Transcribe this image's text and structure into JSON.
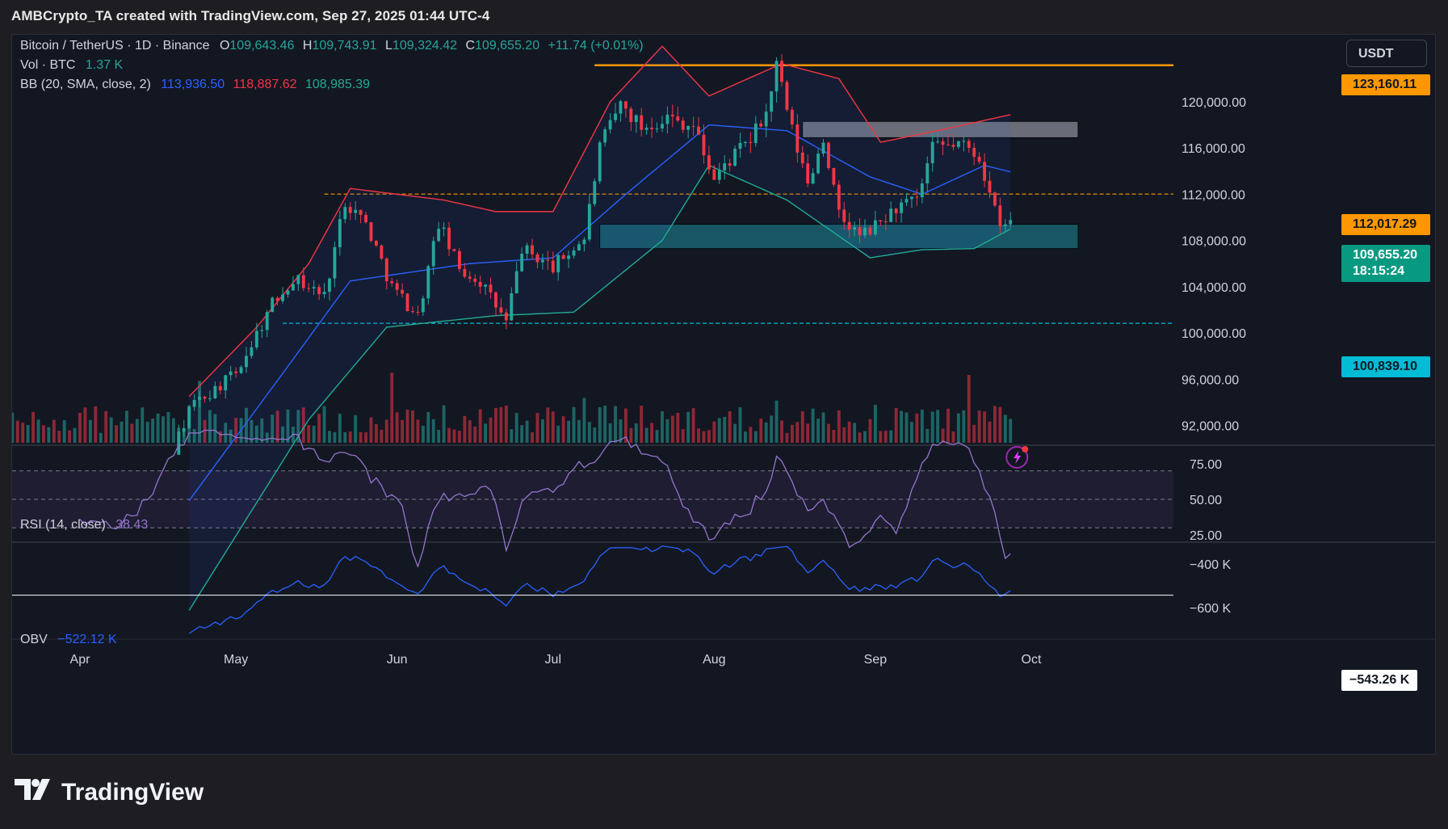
{
  "header": {
    "text": "AMBCrypto_TA created with TradingView.com, Sep 27, 2025 01:44 UTC-4"
  },
  "legend": {
    "symbol": "Bitcoin / TetherUS · 1D · Binance",
    "o_label": "O",
    "o_value": "109,643.46",
    "h_label": "H",
    "h_value": "109,743.91",
    "l_label": "L",
    "l_value": "109,324.42",
    "c_label": "C",
    "c_value": "109,655.20",
    "change": "+11.74 (+0.01%)",
    "vol_label": "Vol · BTC",
    "vol_value": "1.37 K",
    "bb_label": "BB (20, SMA, close, 2)",
    "bb_basis": "113,936.50",
    "bb_upper": "118,887.62",
    "bb_lower": "108,985.39",
    "rsi_label": "RSI (14, close)",
    "rsi_value": "38.43",
    "obv_label": "OBV",
    "obv_value": "−522.12 K"
  },
  "currency_button": "USDT",
  "price_tags": {
    "resistance": "123,160.11",
    "level": "112,017.29",
    "last_price": "109,655.20",
    "countdown": "18:15:24",
    "support": "100,839.10",
    "obv_current": "−543.26 K"
  },
  "colors": {
    "up": "#26a69a",
    "down": "#f23645",
    "bb_basis": "#2962ff",
    "bb_upper": "#f23645",
    "bb_lower": "#22ab94",
    "rsi": "#9575cd",
    "obv": "#2962ff",
    "resistance": "#ff9800",
    "support": "#00bcd4"
  },
  "footer": {
    "brand": "TradingView"
  },
  "chart_data": {
    "type": "candlestick",
    "symbol": "BTCUSDT",
    "price_axis": {
      "ticks": [
        "120,000.00",
        "116,000.00",
        "112,000.00",
        "108,000.00",
        "104,000.00",
        "100,000.00",
        "96,000.00",
        "92,000.00"
      ],
      "range": [
        90500,
        125800
      ]
    },
    "time_axis": {
      "ticks": [
        "Apr",
        "May",
        "Jun",
        "Jul",
        "Aug",
        "Sep",
        "Oct"
      ]
    },
    "rsi_axis": {
      "ticks": [
        "75.00",
        "50.00",
        "25.00"
      ]
    },
    "obv_axis": {
      "ticks": [
        "−400 K",
        "−600 K"
      ]
    },
    "horizontal_levels": [
      {
        "price": 123160.11,
        "style": "solid",
        "color": "#ff9800"
      },
      {
        "price": 112017.29,
        "style": "dashed",
        "color": "#ff9800"
      },
      {
        "price": 100839.1,
        "style": "dashed",
        "color": "#00bcd4"
      }
    ],
    "zones": [
      {
        "from_date": "2025-08-18",
        "to_date": "2025-10-10",
        "low": 116900,
        "high": 118300,
        "color": "grey"
      },
      {
        "from_date": "2025-07-10",
        "to_date": "2025-10-10",
        "low": 107300,
        "high": 109400,
        "color": "teal"
      }
    ],
    "close_path": [
      {
        "date": "2025-03-20",
        "close": 86000
      },
      {
        "date": "2025-04-01",
        "close": 84000
      },
      {
        "date": "2025-04-09",
        "close": 82500
      },
      {
        "date": "2025-04-15",
        "close": 84500
      },
      {
        "date": "2025-04-22",
        "close": 93500
      },
      {
        "date": "2025-05-01",
        "close": 96500
      },
      {
        "date": "2025-05-08",
        "close": 102500
      },
      {
        "date": "2025-05-12",
        "close": 104800
      },
      {
        "date": "2025-05-18",
        "close": 103200
      },
      {
        "date": "2025-05-22",
        "close": 111500
      },
      {
        "date": "2025-05-26",
        "close": 109500
      },
      {
        "date": "2025-05-31",
        "close": 104000
      },
      {
        "date": "2025-06-05",
        "close": 101500
      },
      {
        "date": "2025-06-09",
        "close": 109500
      },
      {
        "date": "2025-06-13",
        "close": 105500
      },
      {
        "date": "2025-06-17",
        "close": 104500
      },
      {
        "date": "2025-06-22",
        "close": 100900
      },
      {
        "date": "2025-06-25",
        "close": 107300
      },
      {
        "date": "2025-07-01",
        "close": 105700
      },
      {
        "date": "2025-07-07",
        "close": 108200
      },
      {
        "date": "2025-07-10",
        "close": 116000
      },
      {
        "date": "2025-07-14",
        "close": 119800
      },
      {
        "date": "2025-07-18",
        "close": 117800
      },
      {
        "date": "2025-07-23",
        "close": 118700
      },
      {
        "date": "2025-07-28",
        "close": 117900
      },
      {
        "date": "2025-08-01",
        "close": 113300
      },
      {
        "date": "2025-08-04",
        "close": 115000
      },
      {
        "date": "2025-08-08",
        "close": 116700
      },
      {
        "date": "2025-08-11",
        "close": 119000
      },
      {
        "date": "2025-08-13",
        "close": 123100
      },
      {
        "date": "2025-08-16",
        "close": 117400
      },
      {
        "date": "2025-08-19",
        "close": 112900
      },
      {
        "date": "2025-08-22",
        "close": 116900
      },
      {
        "date": "2025-08-25",
        "close": 110100
      },
      {
        "date": "2025-08-29",
        "close": 108400
      },
      {
        "date": "2025-09-01",
        "close": 109200
      },
      {
        "date": "2025-09-05",
        "close": 110800
      },
      {
        "date": "2025-09-09",
        "close": 111400
      },
      {
        "date": "2025-09-12",
        "close": 115900
      },
      {
        "date": "2025-09-17",
        "close": 116400
      },
      {
        "date": "2025-09-21",
        "close": 115300
      },
      {
        "date": "2025-09-23",
        "close": 112000
      },
      {
        "date": "2025-09-25",
        "close": 109000
      },
      {
        "date": "2025-09-27",
        "close": 109655.2
      }
    ],
    "bollinger": {
      "upper": [
        {
          "date": "2025-04-22",
          "value": 94500
        },
        {
          "date": "2025-05-05",
          "value": 100500
        },
        {
          "date": "2025-05-15",
          "value": 106000
        },
        {
          "date": "2025-05-23",
          "value": 112500
        },
        {
          "date": "2025-06-10",
          "value": 111500
        },
        {
          "date": "2025-06-20",
          "value": 110500
        },
        {
          "date": "2025-07-01",
          "value": 110500
        },
        {
          "date": "2025-07-12",
          "value": 120000
        },
        {
          "date": "2025-07-22",
          "value": 124800
        },
        {
          "date": "2025-07-31",
          "value": 120500
        },
        {
          "date": "2025-08-14",
          "value": 123300
        },
        {
          "date": "2025-08-25",
          "value": 122000
        },
        {
          "date": "2025-09-02",
          "value": 116500
        },
        {
          "date": "2025-09-13",
          "value": 117500
        },
        {
          "date": "2025-09-27",
          "value": 118887.62
        }
      ],
      "basis": [
        {
          "date": "2025-04-22",
          "value": 85500
        },
        {
          "date": "2025-05-10",
          "value": 96500
        },
        {
          "date": "2025-05-23",
          "value": 104500
        },
        {
          "date": "2025-06-15",
          "value": 106000
        },
        {
          "date": "2025-07-01",
          "value": 106500
        },
        {
          "date": "2025-07-15",
          "value": 112000
        },
        {
          "date": "2025-07-31",
          "value": 118000
        },
        {
          "date": "2025-08-15",
          "value": 117500
        },
        {
          "date": "2025-08-31",
          "value": 113500
        },
        {
          "date": "2025-09-10",
          "value": 112000
        },
        {
          "date": "2025-09-22",
          "value": 114500
        },
        {
          "date": "2025-09-27",
          "value": 113936.5
        }
      ],
      "lower": [
        {
          "date": "2025-04-22",
          "value": 76000
        },
        {
          "date": "2025-05-15",
          "value": 92500
        },
        {
          "date": "2025-05-30",
          "value": 100500
        },
        {
          "date": "2025-06-20",
          "value": 101500
        },
        {
          "date": "2025-07-05",
          "value": 101800
        },
        {
          "date": "2025-07-22",
          "value": 108000
        },
        {
          "date": "2025-07-31",
          "value": 114500
        },
        {
          "date": "2025-08-15",
          "value": 111500
        },
        {
          "date": "2025-08-31",
          "value": 106500
        },
        {
          "date": "2025-09-10",
          "value": 107200
        },
        {
          "date": "2025-09-20",
          "value": 107300
        },
        {
          "date": "2025-09-27",
          "value": 108985.39
        }
      ]
    },
    "rsi_last": 38.43,
    "obv_last_k": -522.12
  }
}
